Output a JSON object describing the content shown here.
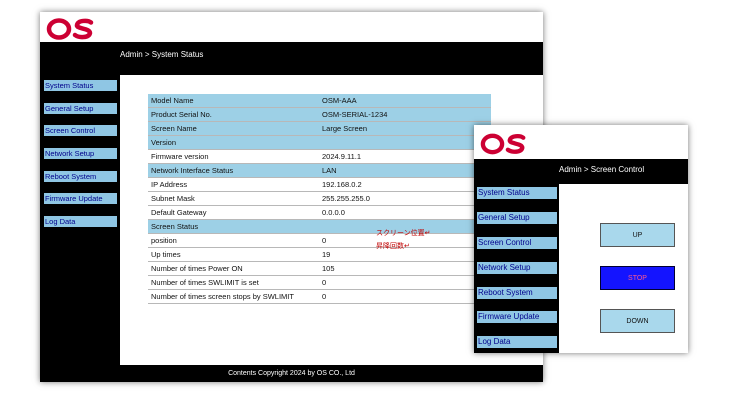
{
  "brand": {
    "logo_text": "OS",
    "logo_color": "#cc0033"
  },
  "status_window": {
    "breadcrumb": "Admin > System Status",
    "sidebar": [
      "System Status",
      "General Setup",
      "Screen Control",
      "Network Setup",
      "Reboot System",
      "Firmware Update",
      "Log Data"
    ],
    "rows": [
      {
        "key": "Model Name",
        "value": "OSM-AAA",
        "highlight": true
      },
      {
        "key": "Product Serial No.",
        "value": "OSM-SERIAL-1234",
        "highlight": true
      },
      {
        "key": "Screen Name",
        "value": "Large Screen",
        "highlight": true
      },
      {
        "key": "Version",
        "value": "",
        "section": true
      },
      {
        "key": "Firmware version",
        "value": "2024.9.11.1"
      },
      {
        "key": "Network Interface Status",
        "value": "LAN",
        "section": true
      },
      {
        "key": "IP Address",
        "value": "192.168.0.2"
      },
      {
        "key": "Subnet Mask",
        "value": "255.255.255.0"
      },
      {
        "key": "Default Gateway",
        "value": "0.0.0.0"
      },
      {
        "key": "Screen Status",
        "value": "",
        "section": true
      },
      {
        "key": "position",
        "value": "0"
      },
      {
        "key": "Up times",
        "value": "19"
      },
      {
        "key": "Number of times Power ON",
        "value": "105"
      },
      {
        "key": "Number of times SWLIMIT is set",
        "value": "0"
      },
      {
        "key": "Number of times screen stops by SWLIMIT",
        "value": "0"
      }
    ],
    "notes": {
      "position": "スクリーン位置↵",
      "up_times": "昇降回数↵"
    },
    "footer": "Contents Copyright 2024 by OS CO., Ltd"
  },
  "control_window": {
    "breadcrumb": "Admin > Screen Control",
    "sidebar": [
      "System Status",
      "General Setup",
      "Screen Control",
      "Network Setup",
      "Reboot System",
      "Firmware Update",
      "Log Data"
    ],
    "buttons": {
      "up": "UP",
      "stop": "STOP",
      "down": "DOWN"
    }
  }
}
